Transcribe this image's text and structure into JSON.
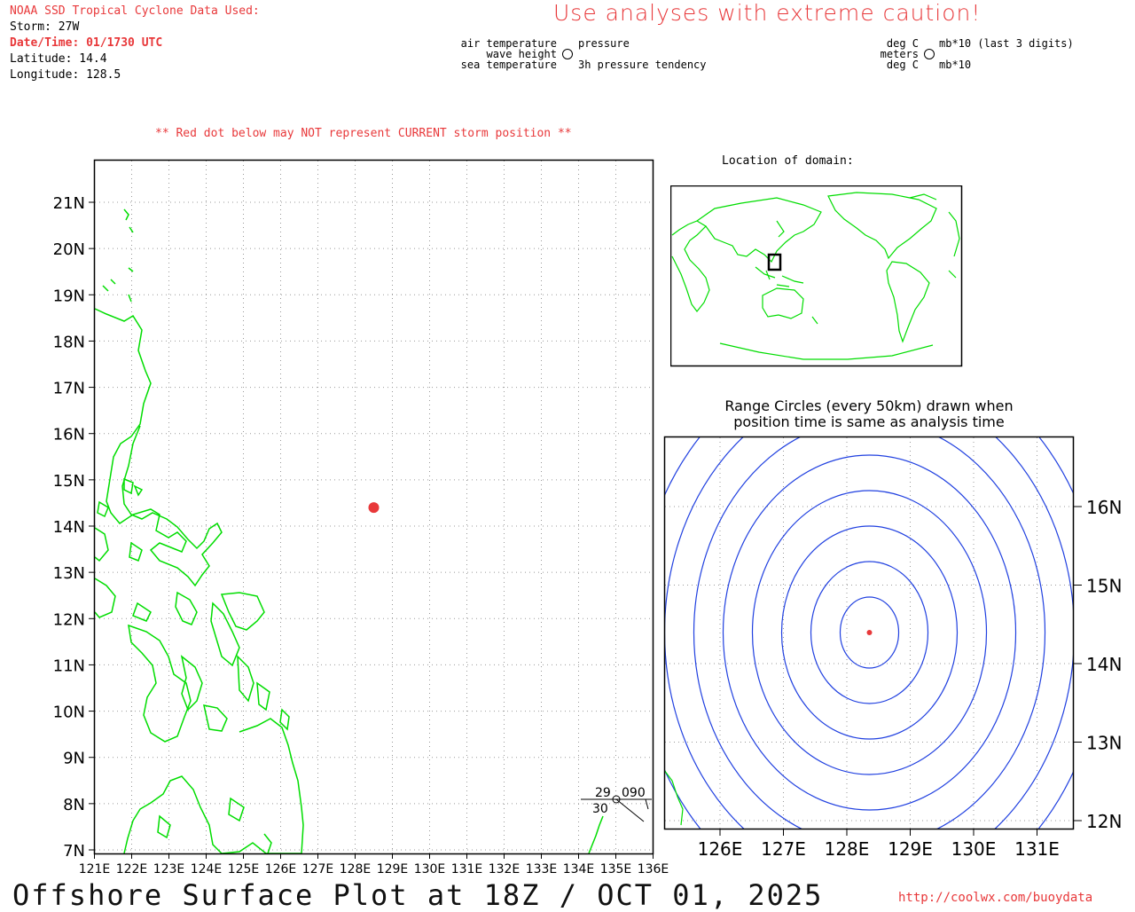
{
  "header": {
    "source_title": "NOAA SSD Tropical Cyclone Data Used:",
    "storm": "Storm: 27W",
    "datetime": "Date/Time: 01/1730 UTC",
    "latitude": "Latitude: 14.4",
    "longitude": "Longitude: 128.5",
    "caution": "Use analyses with extreme caution!"
  },
  "station_legend": {
    "air_temperature": "air temperature",
    "wave_height": "wave height",
    "sea_temperature": "sea temperature",
    "pressure": "pressure",
    "pressure_tendency": "3h pressure tendency",
    "unit_air_temp": "deg C",
    "unit_wave": "meters",
    "unit_sea_temp": "deg C",
    "unit_pressure": "mb*10 (last 3 digits)",
    "unit_tendency": "mb*10"
  },
  "warning": "** Red dot below may NOT represent CURRENT storm position **",
  "main_map": {
    "lat_labels": [
      "7N",
      "8N",
      "9N",
      "10N",
      "11N",
      "12N",
      "13N",
      "14N",
      "15N",
      "16N",
      "17N",
      "18N",
      "19N",
      "20N",
      "21N"
    ],
    "lon_labels": [
      "121E",
      "122E",
      "123E",
      "124E",
      "125E",
      "126E",
      "127E",
      "128E",
      "129E",
      "130E",
      "131E",
      "132E",
      "133E",
      "134E",
      "135E",
      "136E"
    ],
    "storm_position": {
      "lat": 14.4,
      "lon": 128.5
    },
    "station": {
      "air_temp": "29",
      "pressure": "090",
      "sea_temp": "30"
    },
    "colors": {
      "coast": "#00dd00",
      "storm": "#e8383a",
      "grid": "#999999"
    }
  },
  "location_map": {
    "label": "Location of domain:"
  },
  "range_map": {
    "title_line1": "Range Circles (every 50km) drawn when",
    "title_line2": "position time is same as analysis time",
    "lat_labels": [
      "12N",
      "13N",
      "14N",
      "15N",
      "16N"
    ],
    "lon_labels": [
      "126E",
      "127E",
      "128E",
      "129E",
      "130E",
      "131E"
    ],
    "circle_interval_km": 50,
    "colors": {
      "circles": "#2040e0"
    }
  },
  "footer": {
    "title": "Offshore Surface Plot at 18Z / OCT 01, 2025",
    "url": "http://coolwx.com/buoydata"
  }
}
